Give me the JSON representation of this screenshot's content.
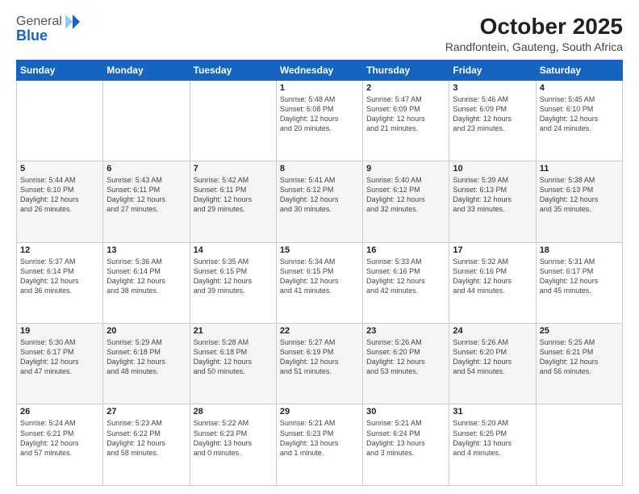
{
  "logo": {
    "general": "General",
    "blue": "Blue"
  },
  "title": "October 2025",
  "subtitle": "Randfontein, Gauteng, South Africa",
  "headers": [
    "Sunday",
    "Monday",
    "Tuesday",
    "Wednesday",
    "Thursday",
    "Friday",
    "Saturday"
  ],
  "weeks": [
    [
      {
        "day": "",
        "info": ""
      },
      {
        "day": "",
        "info": ""
      },
      {
        "day": "",
        "info": ""
      },
      {
        "day": "1",
        "info": "Sunrise: 5:48 AM\nSunset: 6:08 PM\nDaylight: 12 hours\nand 20 minutes."
      },
      {
        "day": "2",
        "info": "Sunrise: 5:47 AM\nSunset: 6:09 PM\nDaylight: 12 hours\nand 21 minutes."
      },
      {
        "day": "3",
        "info": "Sunrise: 5:46 AM\nSunset: 6:09 PM\nDaylight: 12 hours\nand 23 minutes."
      },
      {
        "day": "4",
        "info": "Sunrise: 5:45 AM\nSunset: 6:10 PM\nDaylight: 12 hours\nand 24 minutes."
      }
    ],
    [
      {
        "day": "5",
        "info": "Sunrise: 5:44 AM\nSunset: 6:10 PM\nDaylight: 12 hours\nand 26 minutes."
      },
      {
        "day": "6",
        "info": "Sunrise: 5:43 AM\nSunset: 6:11 PM\nDaylight: 12 hours\nand 27 minutes."
      },
      {
        "day": "7",
        "info": "Sunrise: 5:42 AM\nSunset: 6:11 PM\nDaylight: 12 hours\nand 29 minutes."
      },
      {
        "day": "8",
        "info": "Sunrise: 5:41 AM\nSunset: 6:12 PM\nDaylight: 12 hours\nand 30 minutes."
      },
      {
        "day": "9",
        "info": "Sunrise: 5:40 AM\nSunset: 6:12 PM\nDaylight: 12 hours\nand 32 minutes."
      },
      {
        "day": "10",
        "info": "Sunrise: 5:39 AM\nSunset: 6:13 PM\nDaylight: 12 hours\nand 33 minutes."
      },
      {
        "day": "11",
        "info": "Sunrise: 5:38 AM\nSunset: 6:13 PM\nDaylight: 12 hours\nand 35 minutes."
      }
    ],
    [
      {
        "day": "12",
        "info": "Sunrise: 5:37 AM\nSunset: 6:14 PM\nDaylight: 12 hours\nand 36 minutes."
      },
      {
        "day": "13",
        "info": "Sunrise: 5:36 AM\nSunset: 6:14 PM\nDaylight: 12 hours\nand 38 minutes."
      },
      {
        "day": "14",
        "info": "Sunrise: 5:35 AM\nSunset: 6:15 PM\nDaylight: 12 hours\nand 39 minutes."
      },
      {
        "day": "15",
        "info": "Sunrise: 5:34 AM\nSunset: 6:15 PM\nDaylight: 12 hours\nand 41 minutes."
      },
      {
        "day": "16",
        "info": "Sunrise: 5:33 AM\nSunset: 6:16 PM\nDaylight: 12 hours\nand 42 minutes."
      },
      {
        "day": "17",
        "info": "Sunrise: 5:32 AM\nSunset: 6:16 PM\nDaylight: 12 hours\nand 44 minutes."
      },
      {
        "day": "18",
        "info": "Sunrise: 5:31 AM\nSunset: 6:17 PM\nDaylight: 12 hours\nand 45 minutes."
      }
    ],
    [
      {
        "day": "19",
        "info": "Sunrise: 5:30 AM\nSunset: 6:17 PM\nDaylight: 12 hours\nand 47 minutes."
      },
      {
        "day": "20",
        "info": "Sunrise: 5:29 AM\nSunset: 6:18 PM\nDaylight: 12 hours\nand 48 minutes."
      },
      {
        "day": "21",
        "info": "Sunrise: 5:28 AM\nSunset: 6:18 PM\nDaylight: 12 hours\nand 50 minutes."
      },
      {
        "day": "22",
        "info": "Sunrise: 5:27 AM\nSunset: 6:19 PM\nDaylight: 12 hours\nand 51 minutes."
      },
      {
        "day": "23",
        "info": "Sunrise: 5:26 AM\nSunset: 6:20 PM\nDaylight: 12 hours\nand 53 minutes."
      },
      {
        "day": "24",
        "info": "Sunrise: 5:26 AM\nSunset: 6:20 PM\nDaylight: 12 hours\nand 54 minutes."
      },
      {
        "day": "25",
        "info": "Sunrise: 5:25 AM\nSunset: 6:21 PM\nDaylight: 12 hours\nand 56 minutes."
      }
    ],
    [
      {
        "day": "26",
        "info": "Sunrise: 5:24 AM\nSunset: 6:21 PM\nDaylight: 12 hours\nand 57 minutes."
      },
      {
        "day": "27",
        "info": "Sunrise: 5:23 AM\nSunset: 6:22 PM\nDaylight: 12 hours\nand 58 minutes."
      },
      {
        "day": "28",
        "info": "Sunrise: 5:22 AM\nSunset: 6:23 PM\nDaylight: 13 hours\nand 0 minutes."
      },
      {
        "day": "29",
        "info": "Sunrise: 5:21 AM\nSunset: 6:23 PM\nDaylight: 13 hours\nand 1 minute."
      },
      {
        "day": "30",
        "info": "Sunrise: 5:21 AM\nSunset: 6:24 PM\nDaylight: 13 hours\nand 3 minutes."
      },
      {
        "day": "31",
        "info": "Sunrise: 5:20 AM\nSunset: 6:25 PM\nDaylight: 13 hours\nand 4 minutes."
      },
      {
        "day": "",
        "info": ""
      }
    ]
  ]
}
